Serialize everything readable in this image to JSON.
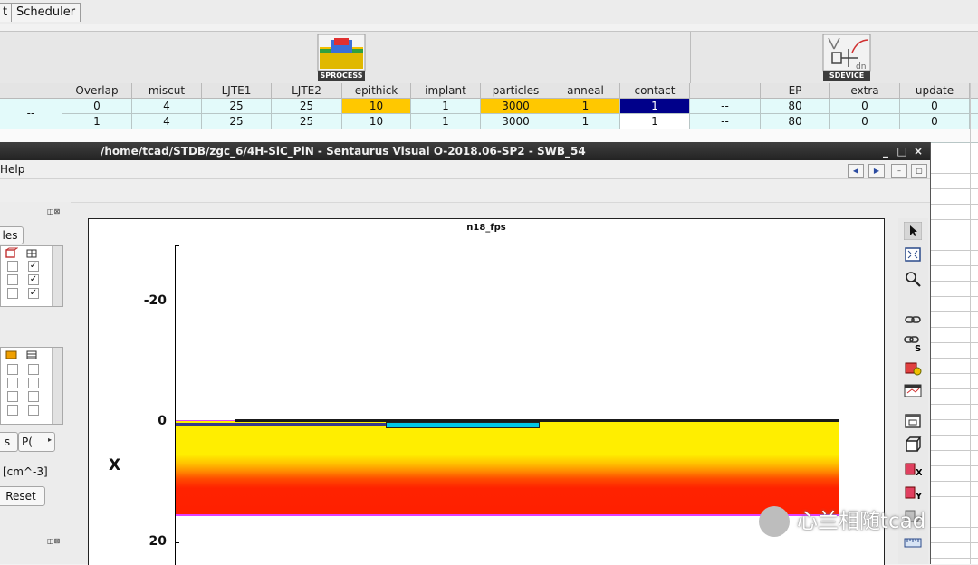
{
  "tabs": [
    "t",
    "Scheduler"
  ],
  "tools": {
    "sprocess_label": "SPROCESS",
    "sdevice_label": "SDEVICE"
  },
  "table": {
    "columns": [
      "Overlap",
      "miscut",
      "LJTE1",
      "LJTE2",
      "epithick",
      "implant",
      "particles",
      "anneal",
      "contact",
      "",
      "EP",
      "extra",
      "update"
    ],
    "left_value": "--",
    "rows": [
      [
        "0",
        "4",
        "25",
        "25",
        "10",
        "1",
        "3000",
        "1",
        "1",
        "--",
        "80",
        "0",
        "0"
      ],
      [
        "1",
        "4",
        "25",
        "25",
        "10",
        "1",
        "3000",
        "1",
        "1",
        "--",
        "80",
        "0",
        "0"
      ]
    ]
  },
  "window": {
    "title": "/home/tcad/STDB/zgc_6/4H-SiC_PiN - Sentaurus Visual O-2018.06-SP2 - SWB_54",
    "menu_help": "Help",
    "controls": {
      "minimize": "_",
      "maximize": "□",
      "close": "×"
    }
  },
  "left_panel": {
    "tab_partial": "les",
    "sub_tab1": "s",
    "sub_tab2": "P(",
    "unit": "[cm^-3]",
    "reset_label": "Reset",
    "checks_top": [
      true,
      true,
      true
    ]
  },
  "plot": {
    "title": "n18_fps",
    "y_ticks": [
      "-20",
      "0",
      "20"
    ],
    "axis_label": "X",
    "layer_colors": {
      "epi": "#ffee00",
      "substrate": "#ff2200",
      "oxide": "#00c8e8",
      "metal": "#1a1a1a",
      "outline": "#e040ff"
    }
  },
  "watermark": "心兰相随tcad"
}
